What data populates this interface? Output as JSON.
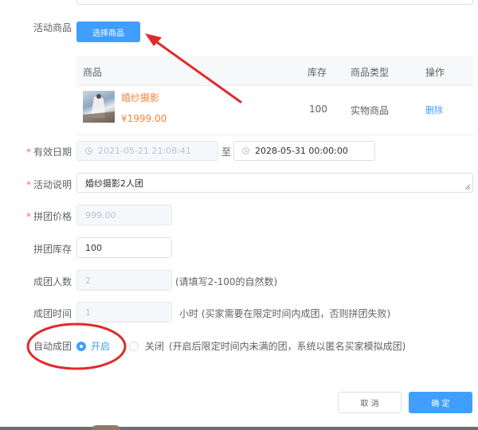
{
  "activity_goods": {
    "label": "活动商品",
    "select_button": "选择商品"
  },
  "goods_table": {
    "headers": [
      "商品",
      "库存",
      "商品类型",
      "操作"
    ],
    "rows": [
      {
        "name": "婚纱摄影",
        "price": "¥1999.00",
        "stock": "100",
        "type": "实物商品",
        "action": "删除"
      }
    ]
  },
  "valid_date": {
    "label": "有效日期",
    "start": "2021-05-21 21:08:41",
    "separator": "至",
    "end": "2028-05-31 00:00:00"
  },
  "description": {
    "label": "活动说明",
    "value": "婚纱摄影2人团"
  },
  "group_price": {
    "label": "拼团价格",
    "value": "999.00"
  },
  "group_stock": {
    "label": "拼团库存",
    "value": "100"
  },
  "group_size": {
    "label": "成团人数",
    "value": "2",
    "hint": "(请填写2-100的自然数)"
  },
  "group_time": {
    "label": "成团时间",
    "value": "1",
    "hint": "小时 (买家需要在限定时间内成团，否则拼团失败)"
  },
  "auto_group": {
    "label": "自动成团",
    "option_on": "开启",
    "option_off": "关闭",
    "hint": "(开启后限定时间内未满的团，系统以匿名买家模拟成团)",
    "selected": "开启"
  },
  "footer": {
    "cancel": "取 消",
    "confirm": "确 定"
  },
  "required_mark": "*",
  "colors": {
    "primary": "#409eff",
    "price": "#f2863a",
    "required": "#f56c6c",
    "annotation": "#e02a2a"
  }
}
